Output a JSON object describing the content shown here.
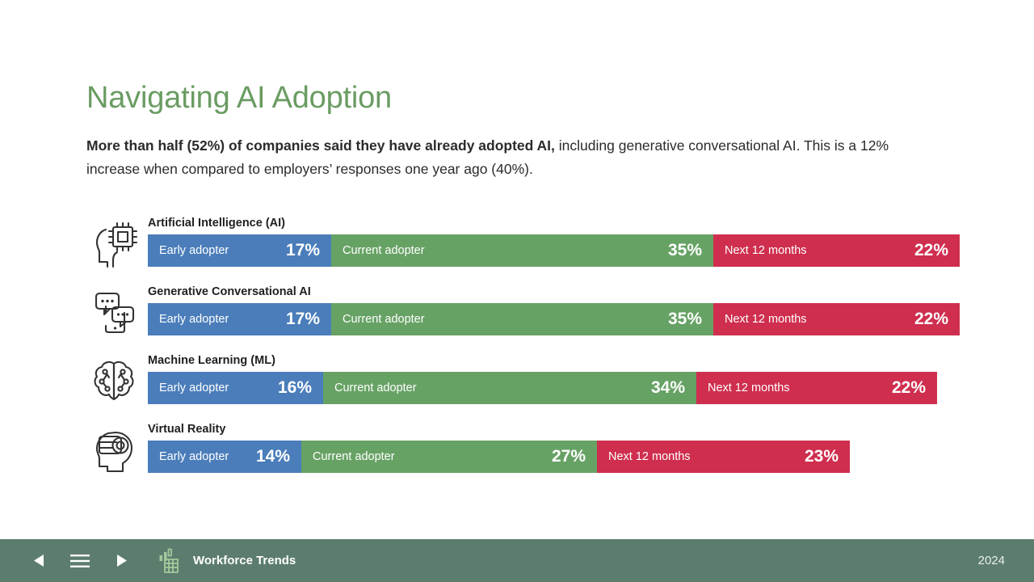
{
  "slide": {
    "title": "Navigating AI Adoption",
    "body": {
      "lead": "More than half (52%) of companies said they have already adopted AI,",
      "rest": " including generative conversational AI. This is a 12% increase when compared to employers’ responses one year ago (40%)."
    }
  },
  "colors": {
    "title_green": "#6a9c62",
    "early_adopter_blue": "#4a7dba",
    "current_adopter_green": "#67a265",
    "next_12_months_red": "#cf2e4e",
    "footer_green": "#5c7d6e"
  },
  "chart_data": {
    "type": "bar",
    "orientation": "horizontal-stacked",
    "title": "Navigating AI Adoption",
    "xlabel": "",
    "ylabel": "",
    "xlim": [
      0,
      100
    ],
    "grid": false,
    "legend_position": "in-bar",
    "categories": [
      "Artificial Intelligence (AI)",
      "Generative Conversational AI",
      "Machine Learning (ML)",
      "Virtual Reality"
    ],
    "series": [
      {
        "name": "Early adopter",
        "values": [
          17,
          17,
          16,
          14
        ],
        "color": "#4a7dba"
      },
      {
        "name": "Current adopter",
        "values": [
          35,
          35,
          34,
          27
        ],
        "color": "#67a265"
      },
      {
        "name": "Next 12 months",
        "values": [
          22,
          22,
          22,
          23
        ],
        "color": "#cf2e4e"
      }
    ],
    "value_suffix": "%"
  },
  "rows": [
    {
      "icon": "ai-chip-head-icon",
      "label": "Artificial Intelligence (AI)",
      "segments": [
        {
          "label": "Early adopter",
          "value": "17%"
        },
        {
          "label": "Current adopter",
          "value": "35%"
        },
        {
          "label": "Next 12 months",
          "value": "22%"
        }
      ]
    },
    {
      "icon": "chat-bubbles-phone-icon",
      "label": "Generative Conversational AI",
      "segments": [
        {
          "label": "Early adopter",
          "value": "17%"
        },
        {
          "label": "Current adopter",
          "value": "35%"
        },
        {
          "label": "Next 12 months",
          "value": "22%"
        }
      ]
    },
    {
      "icon": "brain-network-icon",
      "label": "Machine Learning (ML)",
      "segments": [
        {
          "label": "Early adopter",
          "value": "16%"
        },
        {
          "label": "Current adopter",
          "value": "34%"
        },
        {
          "label": "Next 12 months",
          "value": "22%"
        }
      ]
    },
    {
      "icon": "vr-headset-head-icon",
      "label": "Virtual Reality",
      "segments": [
        {
          "label": "Early adopter",
          "value": "14%"
        },
        {
          "label": "Current adopter",
          "value": "27%"
        },
        {
          "label": "Next 12 months",
          "value": "23%"
        }
      ]
    }
  ],
  "footer": {
    "prev_label": "Previous slide",
    "menu_label": "Menu",
    "next_label": "Next slide",
    "brand_name": "Workforce Trends",
    "year": "2024"
  }
}
